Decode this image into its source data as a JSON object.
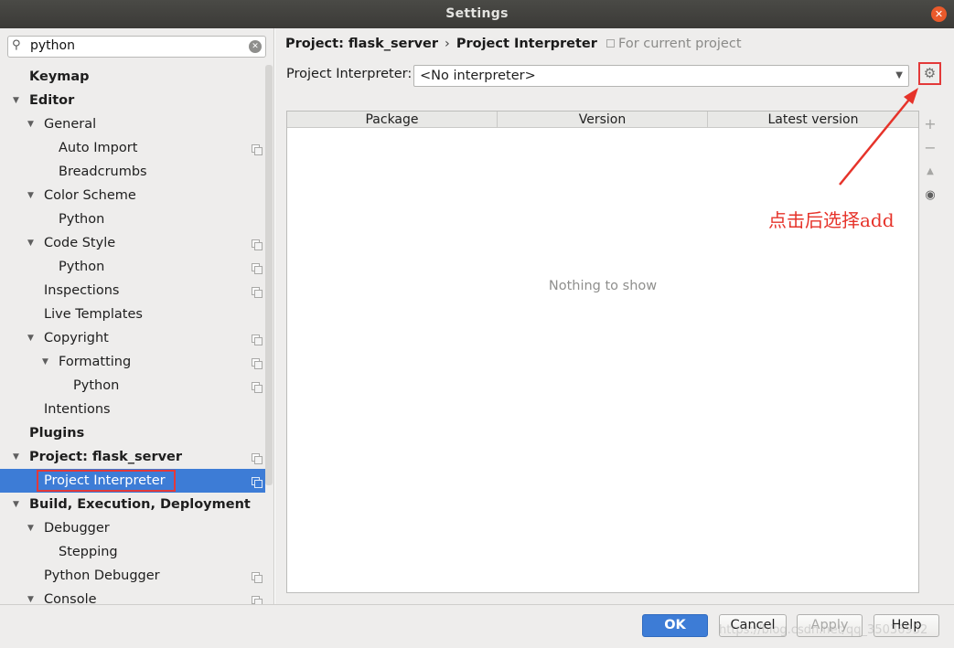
{
  "window": {
    "title": "Settings",
    "close_glyph": "✕"
  },
  "search": {
    "value": "python",
    "icon": "search-icon",
    "clear_glyph": "✕"
  },
  "tree": [
    {
      "label": "Keymap",
      "bold": true,
      "indent": 0,
      "arrow": false,
      "copy": false
    },
    {
      "label": "Editor",
      "bold": true,
      "indent": 0,
      "arrow": true,
      "copy": false
    },
    {
      "label": "General",
      "bold": false,
      "indent": 1,
      "arrow": true,
      "copy": false
    },
    {
      "label": "Auto Import",
      "bold": false,
      "indent": 2,
      "arrow": false,
      "copy": true
    },
    {
      "label": "Breadcrumbs",
      "bold": false,
      "indent": 2,
      "arrow": false,
      "copy": false
    },
    {
      "label": "Color Scheme",
      "bold": false,
      "indent": 1,
      "arrow": true,
      "copy": false
    },
    {
      "label": "Python",
      "bold": false,
      "indent": 2,
      "arrow": false,
      "copy": false
    },
    {
      "label": "Code Style",
      "bold": false,
      "indent": 1,
      "arrow": true,
      "copy": true
    },
    {
      "label": "Python",
      "bold": false,
      "indent": 2,
      "arrow": false,
      "copy": true
    },
    {
      "label": "Inspections",
      "bold": false,
      "indent": 1,
      "arrow": false,
      "copy": true
    },
    {
      "label": "Live Templates",
      "bold": false,
      "indent": 1,
      "arrow": false,
      "copy": false
    },
    {
      "label": "Copyright",
      "bold": false,
      "indent": 1,
      "arrow": true,
      "copy": true
    },
    {
      "label": "Formatting",
      "bold": false,
      "indent": 2,
      "arrow": true,
      "copy": true
    },
    {
      "label": "Python",
      "bold": false,
      "indent": 3,
      "arrow": false,
      "copy": true
    },
    {
      "label": "Intentions",
      "bold": false,
      "indent": 1,
      "arrow": false,
      "copy": false
    },
    {
      "label": "Plugins",
      "bold": true,
      "indent": 0,
      "arrow": false,
      "copy": false
    },
    {
      "label": "Project: flask_server",
      "bold": true,
      "indent": 0,
      "arrow": true,
      "copy": true
    },
    {
      "label": "Project Interpreter",
      "bold": false,
      "indent": 1,
      "arrow": false,
      "copy": true,
      "selected": true
    },
    {
      "label": "Build, Execution, Deployment",
      "bold": true,
      "indent": 0,
      "arrow": true,
      "copy": false
    },
    {
      "label": "Debugger",
      "bold": false,
      "indent": 1,
      "arrow": true,
      "copy": false
    },
    {
      "label": "Stepping",
      "bold": false,
      "indent": 2,
      "arrow": false,
      "copy": false
    },
    {
      "label": "Python Debugger",
      "bold": false,
      "indent": 1,
      "arrow": false,
      "copy": true
    },
    {
      "label": "Console",
      "bold": false,
      "indent": 1,
      "arrow": true,
      "copy": true
    }
  ],
  "breadcrumb": {
    "project": "Project: flask_server",
    "separator": "›",
    "page": "Project Interpreter",
    "scope": "For current project"
  },
  "interpreter": {
    "label": "Project Interpreter:",
    "value": "<No interpreter>",
    "gear_icon": "gear-icon"
  },
  "table": {
    "columns": [
      "Package",
      "Version",
      "Latest version"
    ],
    "empty_text": "Nothing to show"
  },
  "side_tools": [
    {
      "name": "add-package-icon",
      "glyph": "+"
    },
    {
      "name": "remove-package-icon",
      "glyph": "−"
    },
    {
      "name": "upgrade-package-icon",
      "glyph": "▲"
    },
    {
      "name": "show-early-releases-icon",
      "glyph": "◉"
    }
  ],
  "annotation": {
    "text": "点击后选择add",
    "color": "#e6332a"
  },
  "buttons": {
    "ok": "OK",
    "cancel": "Cancel",
    "apply": "Apply",
    "help": "Help"
  },
  "watermark": "https://blog.csdn.net/qq_35036932",
  "colors": {
    "selection": "#3d7cd6",
    "highlight_box": "#e33939"
  }
}
